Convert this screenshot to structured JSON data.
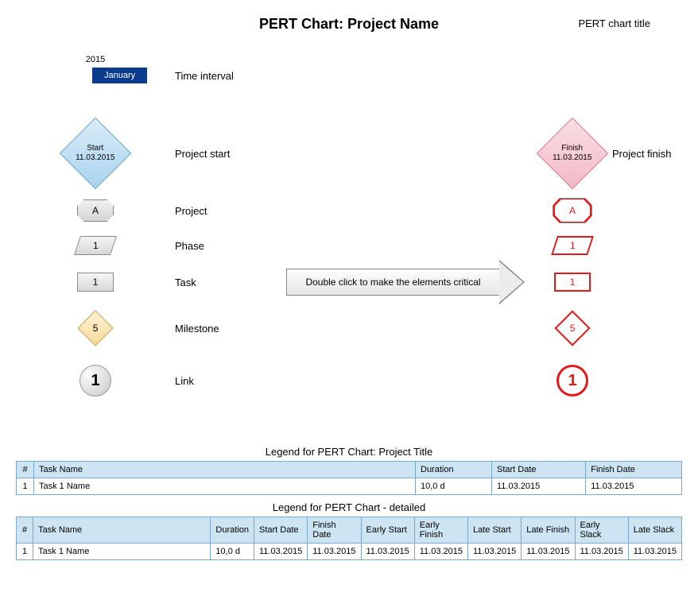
{
  "title": "PERT Chart: Project Name",
  "title_label": "PERT chart title",
  "time_interval": {
    "year": "2015",
    "month": "January",
    "label": "Time interval"
  },
  "project_start": {
    "label": "Project start",
    "text_top": "Start",
    "text_bottom": "11.03.2015"
  },
  "project_finish": {
    "label": "Project finish",
    "text_top": "Finish",
    "text_bottom": "11.03.2015"
  },
  "items": {
    "project": {
      "label": "Project",
      "value": "A"
    },
    "phase": {
      "label": "Phase",
      "value": "1"
    },
    "task": {
      "label": "Task",
      "value": "1"
    },
    "milestone": {
      "label": "Milestone",
      "value": "5"
    },
    "link": {
      "label": "Link",
      "value": "1"
    }
  },
  "arrow_text": "Double click to make the elements critical",
  "table1": {
    "title": "Legend for PERT Chart: Project Title",
    "headers": {
      "num": "#",
      "name": "Task Name",
      "duration": "Duration",
      "start": "Start Date",
      "finish": "Finish Date"
    },
    "row": {
      "num": "1",
      "name": "Task 1 Name",
      "duration": "10,0 d",
      "start": "11.03.2015",
      "finish": "11.03.2015"
    }
  },
  "table2": {
    "title": "Legend for PERT Chart - detailed",
    "headers": {
      "num": "#",
      "name": "Task Name",
      "duration": "Duration",
      "sd": "Start Date",
      "fd": "Finish Date",
      "es": "Early Start",
      "ef": "Early Finish",
      "ls": "Late Start",
      "lf": "Late Finish",
      "esk": "Early Slack",
      "lsk": "Late Slack"
    },
    "row": {
      "num": "1",
      "name": "Task 1 Name",
      "duration": "10,0 d",
      "sd": "11.03.2015",
      "fd": "11.03.2015",
      "es": "11.03.2015",
      "ef": "11.03.2015",
      "ls": "11.03.2015",
      "lf": "11.03.2015",
      "esk": "11.03.2015",
      "lsk": "11.03.2015"
    }
  }
}
